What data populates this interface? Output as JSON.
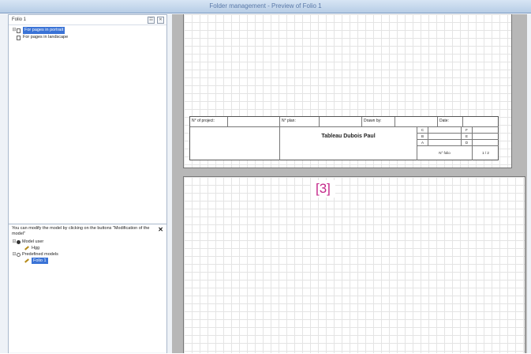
{
  "window": {
    "title": "Folder management - Preview of Folio 1"
  },
  "left_panel": {
    "header": "Folio 1",
    "buttons": [
      "☷",
      "✕"
    ],
    "tree": [
      {
        "label": "For pages in portrait",
        "selected": true
      },
      {
        "label": "For pages in landscape",
        "selected": false
      }
    ]
  },
  "info_panel": {
    "message": "You can modify the model by clicking on the buttons \"Modification of the model\"",
    "close": "✕",
    "tree": [
      {
        "label": "Model user",
        "level": 0,
        "icon": "user-model-icon"
      },
      {
        "label": "Hgg",
        "level": 1,
        "icon": "pen-icon"
      },
      {
        "label": "Predefined models",
        "level": 0,
        "icon": "predefined-model-icon"
      },
      {
        "label": "Folio 1",
        "level": 1,
        "icon": "pen-icon",
        "selected": true
      }
    ]
  },
  "cartouche": {
    "project_label": "N° of project:",
    "plan_label": "N° plan:",
    "drawn_label": "Drawn by:",
    "date_label": "Date:",
    "title": "Tableau Dubois Paul",
    "rev_left": [
      "C",
      "B",
      "A"
    ],
    "rev_right": [
      "F",
      "E",
      "D"
    ],
    "folio_label": "N° folio",
    "folio_value": "1 / 2"
  },
  "callout": "[3]"
}
